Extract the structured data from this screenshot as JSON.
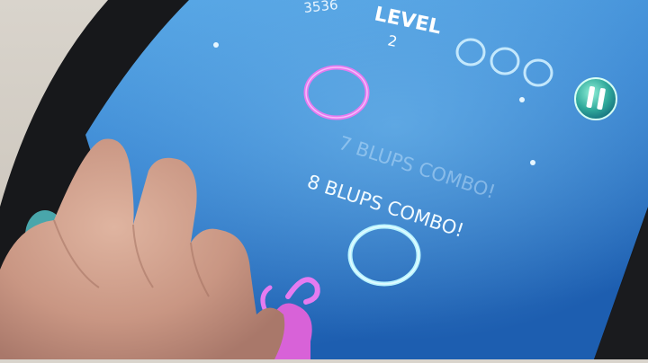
{
  "game": {
    "score": "3536",
    "level_label": "LEVEL",
    "level_value": "2",
    "combo_faded": "7 BLUPS COMBO!",
    "combo_current": "8 BLUPS COMBO!",
    "lives_remaining": 3
  },
  "icons": {
    "pause": "pause-icon",
    "life": "bubble-icon"
  },
  "colors": {
    "screen_top": "#3f8fd6",
    "screen_bottom": "#1f63b4",
    "ring_pink": "#e57bf0",
    "ring_cyan": "#b9f4ff",
    "bezel": "#17181b"
  }
}
